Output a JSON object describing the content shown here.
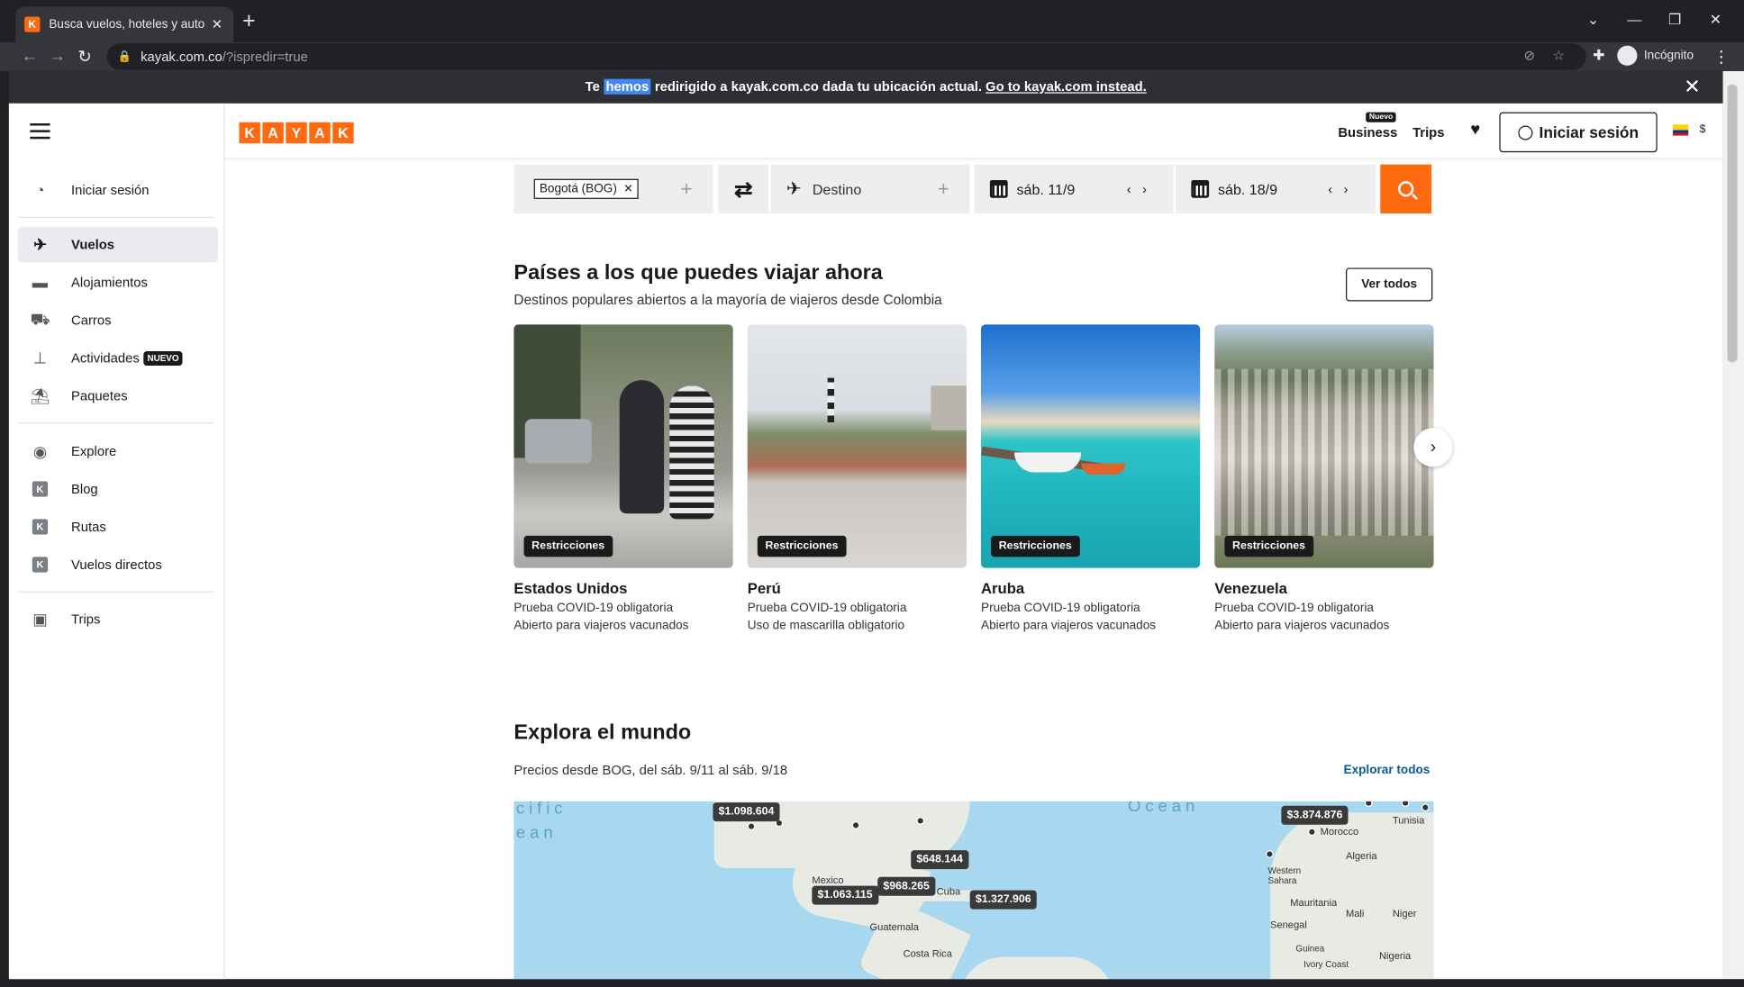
{
  "browser": {
    "tab_title": "Busca vuelos, hoteles y autos de",
    "favicon_letter": "K",
    "url_host": "kayak.com.co",
    "url_path": "/?ispredir=true",
    "incognito_label": "Incógnito"
  },
  "notice": {
    "pre": "Te ",
    "highlight": "hemos",
    "mid": " redirigido a kayak.com.co dada tu ubicación actual. ",
    "link": "Go to kayak.com instead."
  },
  "sidebar": {
    "login": "Iniciar sesión",
    "items": [
      {
        "label": "Vuelos"
      },
      {
        "label": "Alojamientos"
      },
      {
        "label": "Carros"
      },
      {
        "label": "Actividades",
        "badge": "NUEVO"
      },
      {
        "label": "Paquetes"
      },
      {
        "label": "Explore"
      },
      {
        "label": "Blog"
      },
      {
        "label": "Rutas"
      },
      {
        "label": "Vuelos directos"
      },
      {
        "label": "Trips"
      }
    ],
    "k_letter": "K"
  },
  "header": {
    "logo": [
      "K",
      "A",
      "Y",
      "A",
      "K"
    ],
    "business": "Business",
    "business_badge": "Nuevo",
    "trips": "Trips",
    "login": "Iniciar sesión",
    "currency": "$"
  },
  "search": {
    "origin": "Bogotá (BOG)",
    "destination_placeholder": "Destino",
    "depart": "sáb. 11/9",
    "return": "sáb. 18/9"
  },
  "countries": {
    "title": "Países a los que puedes viajar ahora",
    "subtitle": "Destinos populares abiertos a la mayoría de viajeros desde Colombia",
    "see_all": "Ver todos",
    "badge": "Restricciones",
    "cards": [
      {
        "name": "Estados Unidos",
        "line1": "Prueba COVID-19 obligatoria",
        "line2": "Abierto para viajeros vacunados"
      },
      {
        "name": "Perú",
        "line1": "Prueba COVID-19 obligatoria",
        "line2": "Uso de mascarilla obligatorio"
      },
      {
        "name": "Aruba",
        "line1": "Prueba COVID-19 obligatoria",
        "line2": "Abierto para viajeros vacunados"
      },
      {
        "name": "Venezuela",
        "line1": "Prueba COVID-19 obligatoria",
        "line2": "Abierto para viajeros vacunados"
      }
    ]
  },
  "explore": {
    "title": "Explora el mundo",
    "subtitle": "Precios desde BOG, del sáb. 9/11 al sáb. 9/18",
    "link": "Explorar todos",
    "prices": [
      "$1.098.604",
      "$648.144",
      "$968.265",
      "$1.063.115",
      "$1.327.906",
      "$3.874.876"
    ],
    "labels": [
      "Mexico",
      "Cuba",
      "Guatemala",
      "Costa Rica",
      "Tunisia",
      "Morocco",
      "Algeria",
      "Western Sahara",
      "Mauritania",
      "Mali",
      "Niger",
      "Senegal",
      "Guinea",
      "Nigeria",
      "Ivory Coast",
      "Ocean",
      "cific",
      "ean"
    ]
  },
  "colors": {
    "brand": "#ff690f",
    "dark": "#1a1a1a",
    "link": "#0a5b8f"
  }
}
